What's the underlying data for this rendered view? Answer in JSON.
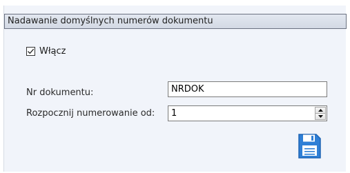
{
  "group": {
    "title": "Nadawanie domyślnych numerów dokumentu"
  },
  "enable": {
    "label": "Włącz",
    "checked": true
  },
  "doc_number": {
    "label": "Nr dokumentu:",
    "value": "NRDOK"
  },
  "start_number": {
    "label": "Rozpocznij numerowanie od:",
    "value": "1"
  },
  "icons": {
    "save": "floppy-disk-icon",
    "checkbox": "checkmark-icon",
    "spin_up": "triangle-up-icon",
    "spin_down": "triangle-down-icon"
  },
  "colors": {
    "panel_bg": "#f1f4fa",
    "header_bg": "#d9dee8",
    "save_icon": "#2f7fd6"
  }
}
